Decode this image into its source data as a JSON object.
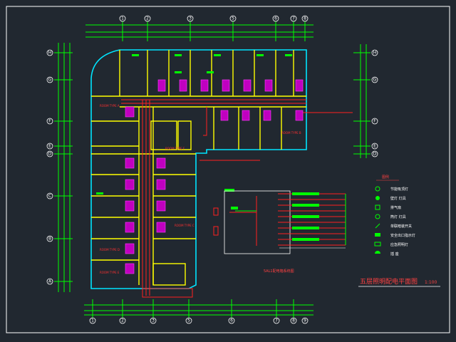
{
  "drawing": {
    "title": "五层照明配电平面图",
    "scale": "1:100",
    "panel_caption": "5AL1配电箱系统图",
    "legend_header": "图例",
    "colors": {
      "background": "#212830",
      "walls": "#ffff00",
      "exterior": "#00e5ff",
      "wiring": "#ff2020",
      "fixtures": "#c000c0",
      "dimensions": "#00ff00",
      "text": "#ff4040"
    }
  },
  "axes": {
    "top": [
      "1",
      "2",
      "3",
      "5",
      "6",
      "7",
      "8",
      "9"
    ],
    "bottom": [
      "1",
      "2",
      "3",
      "5",
      "6",
      "7",
      "8",
      "9"
    ],
    "left": [
      "H",
      "G",
      "F",
      "E",
      "D",
      "C",
      "B",
      "A"
    ]
  },
  "rooms": [
    "ROOM TYPE A",
    "ROOM TYPE B",
    "ROOM TYPE C",
    "ROOM TYPE D",
    "ROOM TYPE E",
    "ROOM TYPE F"
  ],
  "legend": [
    {
      "icon": "ceiling-lamp",
      "label": "节能吸顶灯"
    },
    {
      "icon": "wall-lamp",
      "label": "壁灯 灯具"
    },
    {
      "icon": "exhaust-fan",
      "label": "排气扇"
    },
    {
      "icon": "downlight",
      "label": "筒灯 灯具"
    },
    {
      "icon": "switch",
      "label": "单联暗装开关"
    },
    {
      "icon": "exit-sign",
      "label": "安全出口指示灯"
    },
    {
      "icon": "emergency",
      "label": "应急照明灯"
    },
    {
      "icon": "socket",
      "label": "插 座"
    }
  ]
}
